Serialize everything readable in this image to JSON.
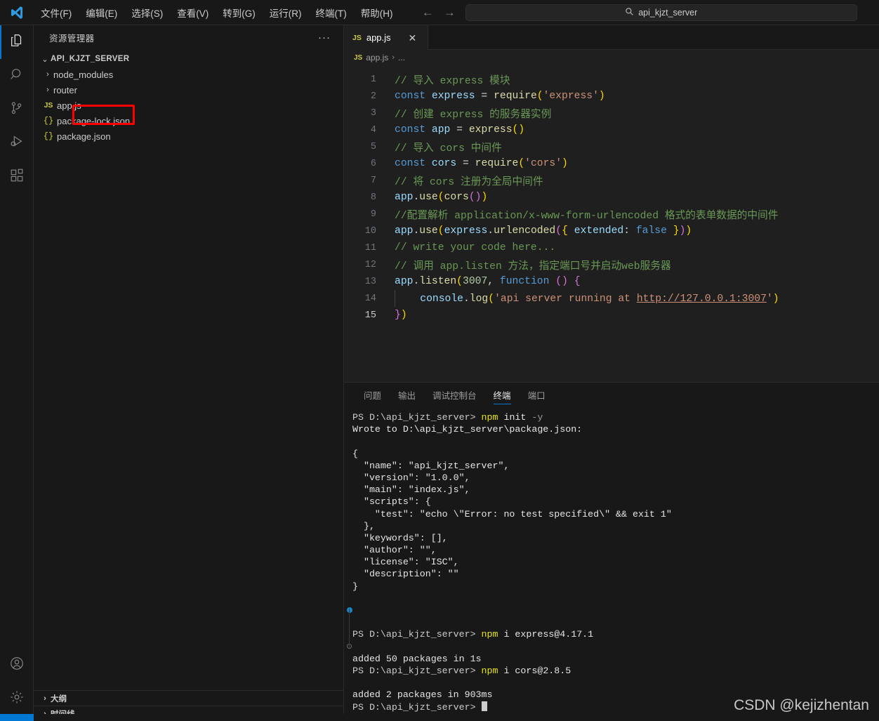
{
  "titlebar": {
    "logo_icon": "vscode-logo-icon",
    "menus": [
      {
        "label": "文件(F)"
      },
      {
        "label": "编辑(E)"
      },
      {
        "label": "选择(S)"
      },
      {
        "label": "查看(V)"
      },
      {
        "label": "转到(G)"
      },
      {
        "label": "运行(R)"
      },
      {
        "label": "终端(T)"
      },
      {
        "label": "帮助(H)"
      }
    ],
    "back_arrow": "←",
    "forward_arrow": "→",
    "search_icon": "search-icon",
    "quick_input_value": "api_kjzt_server"
  },
  "activitybar": {
    "items": [
      {
        "name": "explorer",
        "icon": "files-icon",
        "active": true
      },
      {
        "name": "search",
        "icon": "search-icon",
        "active": false
      },
      {
        "name": "source-control",
        "icon": "source-control-icon",
        "active": false
      },
      {
        "name": "run-debug",
        "icon": "run-and-debug-icon",
        "active": false
      },
      {
        "name": "extensions",
        "icon": "extensions-icon",
        "active": false
      }
    ],
    "bottom": [
      {
        "name": "accounts",
        "icon": "account-icon"
      },
      {
        "name": "manage",
        "icon": "gear-icon"
      }
    ]
  },
  "sidebar": {
    "title": "资源管理器",
    "more_actions": "···",
    "root": {
      "label": "API_KJZT_SERVER",
      "chevron": "⌄"
    },
    "tree": [
      {
        "label": "node_modules",
        "type": "folder",
        "chevron": "›",
        "icon": ""
      },
      {
        "label": "router",
        "type": "folder",
        "chevron": "›",
        "icon": "",
        "highlighted": true
      },
      {
        "label": "app.js",
        "type": "file",
        "icon": "JS"
      },
      {
        "label": "package-lock.json",
        "type": "file",
        "icon": "{}"
      },
      {
        "label": "package.json",
        "type": "file",
        "icon": "{}"
      }
    ],
    "bottom_panes": [
      {
        "label": "大纲",
        "chevron": "›"
      },
      {
        "label": "时间线",
        "chevron": "›"
      }
    ],
    "annotation_color": "#ff0000"
  },
  "editor": {
    "tab": {
      "icon": "JS",
      "label": "app.js",
      "close": "✕"
    },
    "breadcrumb": {
      "icon": "JS",
      "file": "app.js",
      "sep": "›",
      "rest": "..."
    },
    "lines": [
      {
        "n": "1",
        "tokens": [
          {
            "t": "// 导入 express 模块",
            "c": "c-com"
          }
        ]
      },
      {
        "n": "2",
        "tokens": [
          {
            "t": "const",
            "c": "c-kw"
          },
          {
            "t": " ",
            "c": "c-op"
          },
          {
            "t": "express",
            "c": "c-var"
          },
          {
            "t": " = ",
            "c": "c-op"
          },
          {
            "t": "require",
            "c": "c-fn"
          },
          {
            "t": "(",
            "c": "c-p1"
          },
          {
            "t": "'express'",
            "c": "c-str"
          },
          {
            "t": ")",
            "c": "c-p1"
          }
        ]
      },
      {
        "n": "3",
        "tokens": [
          {
            "t": "// 创建 express 的服务器实例",
            "c": "c-com"
          }
        ]
      },
      {
        "n": "4",
        "tokens": [
          {
            "t": "const",
            "c": "c-kw"
          },
          {
            "t": " ",
            "c": "c-op"
          },
          {
            "t": "app",
            "c": "c-var"
          },
          {
            "t": " = ",
            "c": "c-op"
          },
          {
            "t": "express",
            "c": "c-fn"
          },
          {
            "t": "(",
            "c": "c-p1"
          },
          {
            "t": ")",
            "c": "c-p1"
          }
        ]
      },
      {
        "n": "5",
        "tokens": [
          {
            "t": "// 导入 cors 中间件",
            "c": "c-com"
          }
        ]
      },
      {
        "n": "6",
        "tokens": [
          {
            "t": "const",
            "c": "c-kw"
          },
          {
            "t": " ",
            "c": "c-op"
          },
          {
            "t": "cors",
            "c": "c-var"
          },
          {
            "t": " = ",
            "c": "c-op"
          },
          {
            "t": "require",
            "c": "c-fn"
          },
          {
            "t": "(",
            "c": "c-p1"
          },
          {
            "t": "'cors'",
            "c": "c-str"
          },
          {
            "t": ")",
            "c": "c-p1"
          }
        ]
      },
      {
        "n": "7",
        "tokens": [
          {
            "t": "// 将 cors 注册为全局中间件",
            "c": "c-com"
          }
        ]
      },
      {
        "n": "8",
        "tokens": [
          {
            "t": "app",
            "c": "c-var"
          },
          {
            "t": ".",
            "c": "c-op"
          },
          {
            "t": "use",
            "c": "c-fn"
          },
          {
            "t": "(",
            "c": "c-p1"
          },
          {
            "t": "cors",
            "c": "c-fn"
          },
          {
            "t": "(",
            "c": "c-p2"
          },
          {
            "t": ")",
            "c": "c-p2"
          },
          {
            "t": ")",
            "c": "c-p1"
          }
        ]
      },
      {
        "n": "9",
        "tokens": [
          {
            "t": "//配置解析 application/x-www-form-urlencoded 格式的表单数据的中间件",
            "c": "c-com"
          }
        ]
      },
      {
        "n": "10",
        "tokens": [
          {
            "t": "app",
            "c": "c-var"
          },
          {
            "t": ".",
            "c": "c-op"
          },
          {
            "t": "use",
            "c": "c-fn"
          },
          {
            "t": "(",
            "c": "c-p1"
          },
          {
            "t": "express",
            "c": "c-var"
          },
          {
            "t": ".",
            "c": "c-op"
          },
          {
            "t": "urlencoded",
            "c": "c-fn"
          },
          {
            "t": "(",
            "c": "c-p2"
          },
          {
            "t": "{",
            "c": "c-p1"
          },
          {
            "t": " extended",
            "c": "c-var"
          },
          {
            "t": ": ",
            "c": "c-op"
          },
          {
            "t": "false",
            "c": "c-kw"
          },
          {
            "t": " ",
            "c": "c-op"
          },
          {
            "t": "}",
            "c": "c-p1"
          },
          {
            "t": ")",
            "c": "c-p2"
          },
          {
            "t": ")",
            "c": "c-p1"
          }
        ]
      },
      {
        "n": "11",
        "tokens": [
          {
            "t": "// write your code here...",
            "c": "c-com"
          }
        ]
      },
      {
        "n": "12",
        "tokens": [
          {
            "t": "// 调用 app.listen 方法，指定端口号并启动web服务器",
            "c": "c-com"
          }
        ]
      },
      {
        "n": "13",
        "tokens": [
          {
            "t": "app",
            "c": "c-var"
          },
          {
            "t": ".",
            "c": "c-op"
          },
          {
            "t": "listen",
            "c": "c-fn"
          },
          {
            "t": "(",
            "c": "c-p1"
          },
          {
            "t": "3007",
            "c": "c-num"
          },
          {
            "t": ", ",
            "c": "c-op"
          },
          {
            "t": "function",
            "c": "c-kw"
          },
          {
            "t": " ",
            "c": "c-op"
          },
          {
            "t": "(",
            "c": "c-p2"
          },
          {
            "t": ")",
            "c": "c-p2"
          },
          {
            "t": " ",
            "c": "c-op"
          },
          {
            "t": "{",
            "c": "c-p2"
          }
        ]
      },
      {
        "n": "14",
        "indent": true,
        "tokens": [
          {
            "t": "    ",
            "c": "c-op"
          },
          {
            "t": "console",
            "c": "c-var"
          },
          {
            "t": ".",
            "c": "c-op"
          },
          {
            "t": "log",
            "c": "c-fn"
          },
          {
            "t": "(",
            "c": "c-p1"
          },
          {
            "t": "'api server running at ",
            "c": "c-str"
          },
          {
            "t": "http://127.0.0.1:3007",
            "c": "c-link"
          },
          {
            "t": "'",
            "c": "c-str"
          },
          {
            "t": ")",
            "c": "c-p1"
          }
        ]
      },
      {
        "n": "15",
        "active": true,
        "tokens": [
          {
            "t": "}",
            "c": "c-p2"
          },
          {
            "t": ")",
            "c": "c-p1"
          }
        ]
      }
    ]
  },
  "panel": {
    "tabs": [
      {
        "label": "问题",
        "active": false
      },
      {
        "label": "输出",
        "active": false
      },
      {
        "label": "调试控制台",
        "active": false
      },
      {
        "label": "终端",
        "active": true
      },
      {
        "label": "端口",
        "active": false
      }
    ],
    "terminal_lines": [
      {
        "segs": [
          {
            "t": "PS D:\\api_kjzt_server> ",
            "c": "t-ps"
          },
          {
            "t": "npm",
            "c": "t-cmd"
          },
          {
            "t": " init ",
            "c": "t-white"
          },
          {
            "t": "-y",
            "c": "t-dim"
          }
        ]
      },
      {
        "segs": [
          {
            "t": "Wrote to D:\\api_kjzt_server\\package.json:",
            "c": "t-white"
          }
        ]
      },
      {
        "segs": [
          {
            "t": "",
            "c": "t-white"
          }
        ]
      },
      {
        "segs": [
          {
            "t": "{",
            "c": "t-white"
          }
        ]
      },
      {
        "segs": [
          {
            "t": "  \"name\": \"api_kjzt_server\",",
            "c": "t-white"
          }
        ]
      },
      {
        "segs": [
          {
            "t": "  \"version\": \"1.0.0\",",
            "c": "t-white"
          }
        ]
      },
      {
        "segs": [
          {
            "t": "  \"main\": \"index.js\",",
            "c": "t-white"
          }
        ]
      },
      {
        "segs": [
          {
            "t": "  \"scripts\": {",
            "c": "t-white"
          }
        ]
      },
      {
        "segs": [
          {
            "t": "    \"test\": \"echo \\\"Error: no test specified\\\" && exit 1\"",
            "c": "t-white"
          }
        ]
      },
      {
        "segs": [
          {
            "t": "  },",
            "c": "t-white"
          }
        ]
      },
      {
        "segs": [
          {
            "t": "  \"keywords\": [],",
            "c": "t-white"
          }
        ]
      },
      {
        "segs": [
          {
            "t": "  \"author\": \"\",",
            "c": "t-white"
          }
        ]
      },
      {
        "segs": [
          {
            "t": "  \"license\": \"ISC\",",
            "c": "t-white"
          }
        ]
      },
      {
        "segs": [
          {
            "t": "  \"description\": \"\"",
            "c": "t-white"
          }
        ]
      },
      {
        "segs": [
          {
            "t": "}",
            "c": "t-white"
          }
        ]
      },
      {
        "segs": [
          {
            "t": "",
            "c": "t-white"
          }
        ]
      },
      {
        "segs": [
          {
            "t": "",
            "c": "t-white"
          }
        ]
      },
      {
        "segs": [
          {
            "t": "",
            "c": "t-white"
          }
        ]
      },
      {
        "segs": [
          {
            "t": "PS D:\\api_kjzt_server> ",
            "c": "t-ps"
          },
          {
            "t": "npm",
            "c": "t-cmd"
          },
          {
            "t": " i express@4.17.1",
            "c": "t-white"
          }
        ]
      },
      {
        "segs": [
          {
            "t": "",
            "c": "t-white"
          }
        ]
      },
      {
        "segs": [
          {
            "t": "added 50 packages in 1s",
            "c": "t-white"
          }
        ]
      },
      {
        "segs": [
          {
            "t": "PS D:\\api_kjzt_server> ",
            "c": "t-ps"
          },
          {
            "t": "npm",
            "c": "t-cmd"
          },
          {
            "t": " i cors@2.8.5",
            "c": "t-white"
          }
        ]
      },
      {
        "segs": [
          {
            "t": "",
            "c": "t-white"
          }
        ]
      },
      {
        "segs": [
          {
            "t": "added 2 packages in 903ms",
            "c": "t-white"
          }
        ]
      },
      {
        "segs": [
          {
            "t": "PS D:\\api_kjzt_server> ",
            "c": "t-ps"
          },
          {
            "t": "",
            "c": "t-white"
          }
        ],
        "cursor": true
      }
    ]
  },
  "watermark": "CSDN @kejizhentan",
  "colors": {
    "accent": "#0078d4",
    "annotation": "#ff0000",
    "editor_bg": "#1f1f1f",
    "chrome_bg": "#181818"
  }
}
